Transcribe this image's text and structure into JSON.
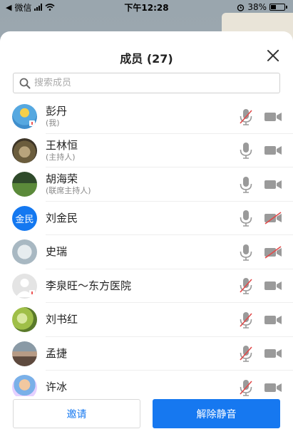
{
  "status": {
    "carrier": "微信",
    "time": "下午12:28",
    "battery": "38%"
  },
  "panel": {
    "title": "成员 (27)",
    "search_placeholder": "搜索成员"
  },
  "members": [
    {
      "name": "彭丹",
      "role": "(我)",
      "avatar": "photo-duck",
      "mic_muted": true,
      "cam_off": false
    },
    {
      "name": "王林恒",
      "role": "(主持人)",
      "avatar": "photo-rock",
      "mic_muted": false,
      "cam_off": false
    },
    {
      "name": "胡海荣",
      "role": "(联席主持人)",
      "avatar": "photo-tree",
      "mic_muted": false,
      "cam_off": false
    },
    {
      "name": "刘金民",
      "role": "",
      "avatar_text": "金民",
      "mic_muted": false,
      "cam_off": true
    },
    {
      "name": "史瑞",
      "role": "",
      "avatar": "photo-sketch",
      "mic_muted": false,
      "cam_off": true
    },
    {
      "name": "李泉旺～东方医院",
      "role": "",
      "avatar": "default-person",
      "mic_muted": true,
      "cam_off": false
    },
    {
      "name": "刘书红",
      "role": "",
      "avatar": "photo-grapes",
      "mic_muted": true,
      "cam_off": false
    },
    {
      "name": "孟捷",
      "role": "",
      "avatar": "photo-landscape",
      "mic_muted": true,
      "cam_off": false
    },
    {
      "name": "许冰",
      "role": "",
      "avatar": "photo-cartoon",
      "mic_muted": true,
      "cam_off": false
    }
  ],
  "footer": {
    "invite_label": "邀请",
    "unmute_label": "解除静音"
  },
  "colors": {
    "accent": "#1678f0",
    "muted_red": "#e24a4a",
    "icon_gray": "#9a9a9a"
  }
}
